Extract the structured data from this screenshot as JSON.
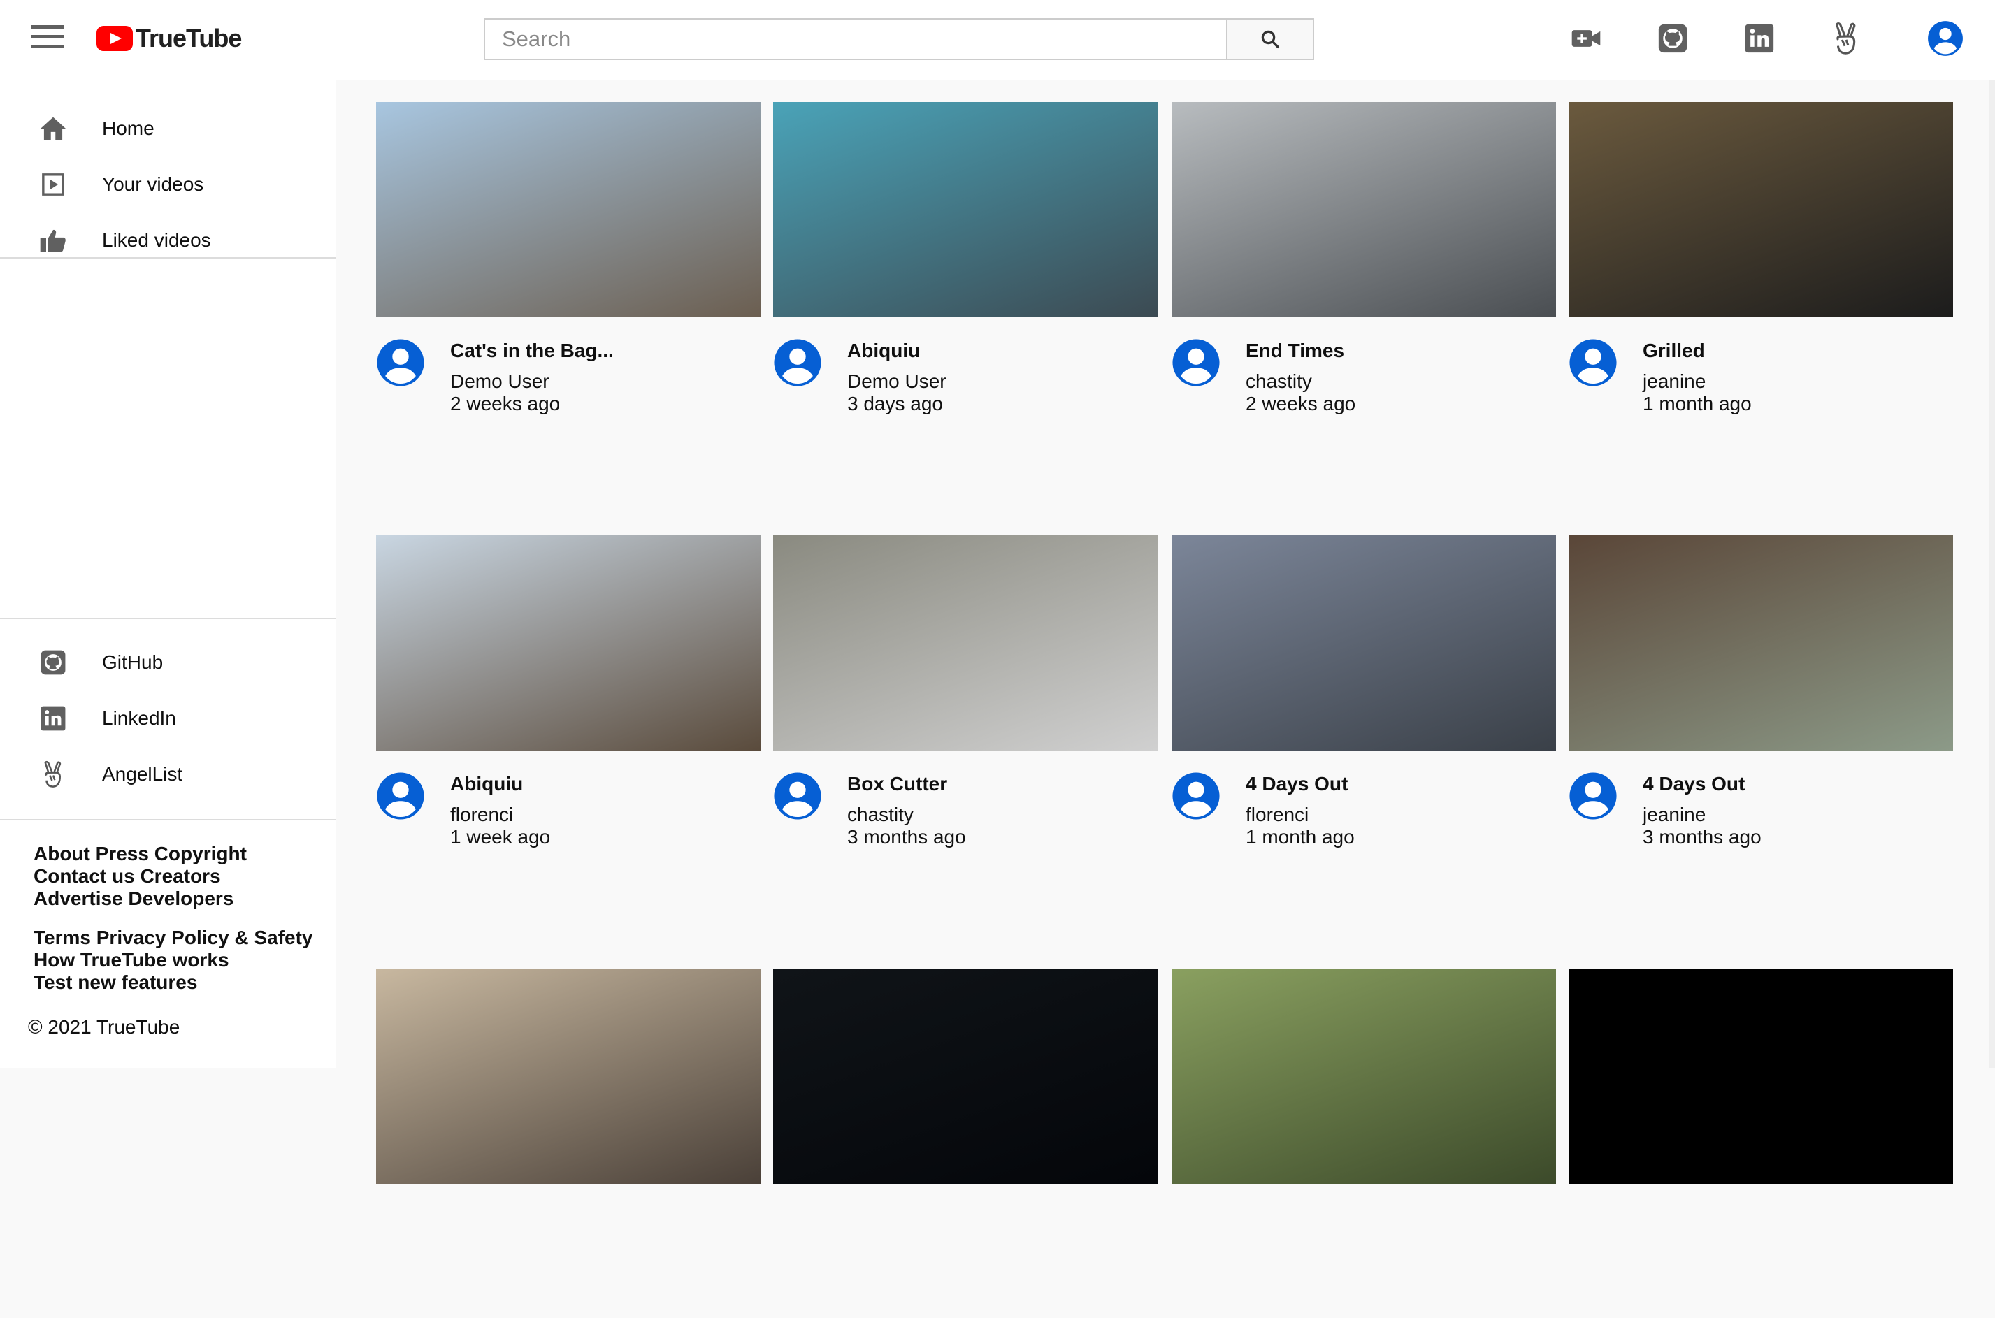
{
  "app": {
    "name": "TrueTube"
  },
  "search": {
    "placeholder": "Search"
  },
  "header_icons": [
    "create-video-icon",
    "github-icon",
    "linkedin-icon",
    "angellist-icon",
    "account-icon"
  ],
  "sidebar": {
    "nav": [
      {
        "label": "Home",
        "icon": "home-icon"
      },
      {
        "label": "Your videos",
        "icon": "your-videos-icon"
      },
      {
        "label": "Liked videos",
        "icon": "thumbs-up-icon"
      }
    ],
    "social": [
      {
        "label": "GitHub",
        "icon": "github-icon"
      },
      {
        "label": "LinkedIn",
        "icon": "linkedin-icon"
      },
      {
        "label": "AngelList",
        "icon": "angellist-icon"
      }
    ],
    "footer": {
      "line1": "About Press Copyright",
      "line2": "Contact us Creators",
      "line3": "Advertise Developers",
      "line4": "Terms Privacy Policy & Safety",
      "line5": "How TrueTube works",
      "line6": "Test new features",
      "copyright": "© 2021 TrueTube"
    }
  },
  "videos": [
    {
      "title": "Cat's in the Bag...",
      "channel": "Demo User",
      "time": "2 weeks ago",
      "thumb_colors": [
        "#a8c6e0",
        "#6b5e50"
      ]
    },
    {
      "title": "Abiquiu",
      "channel": "Demo User",
      "time": "3 days ago",
      "thumb_colors": [
        "#4aa3b8",
        "#3c4a52"
      ]
    },
    {
      "title": "End Times",
      "channel": "chastity",
      "time": "2 weeks ago",
      "thumb_colors": [
        "#b8bcbf",
        "#4a4e52"
      ]
    },
    {
      "title": "Grilled",
      "channel": "jeanine",
      "time": "1 month ago",
      "thumb_colors": [
        "#6b5a3e",
        "#1c1c1c"
      ]
    },
    {
      "title": "Abiquiu",
      "channel": "florenci",
      "time": "1 week ago",
      "thumb_colors": [
        "#c9d6e2",
        "#5a4b3c"
      ]
    },
    {
      "title": "Box Cutter",
      "channel": "chastity",
      "time": "3 months ago",
      "thumb_colors": [
        "#8a8a80",
        "#d0d0d0"
      ]
    },
    {
      "title": "4 Days Out",
      "channel": "florenci",
      "time": "1 month ago",
      "thumb_colors": [
        "#7c8699",
        "#3a4048"
      ]
    },
    {
      "title": "4 Days Out",
      "channel": "jeanine",
      "time": "3 months ago",
      "thumb_colors": [
        "#5a4638",
        "#8c9a88"
      ]
    },
    {
      "thumb_colors": [
        "#c8b8a0",
        "#4a4038"
      ]
    },
    {
      "thumb_colors": [
        "#101418",
        "#04060a"
      ]
    },
    {
      "thumb_colors": [
        "#8aa060",
        "#3c4a2a"
      ]
    },
    {
      "thumb_colors": [
        "#000000",
        "#000000"
      ]
    }
  ],
  "colors": {
    "accent": "#065fd4",
    "brand": "#ff0000"
  }
}
